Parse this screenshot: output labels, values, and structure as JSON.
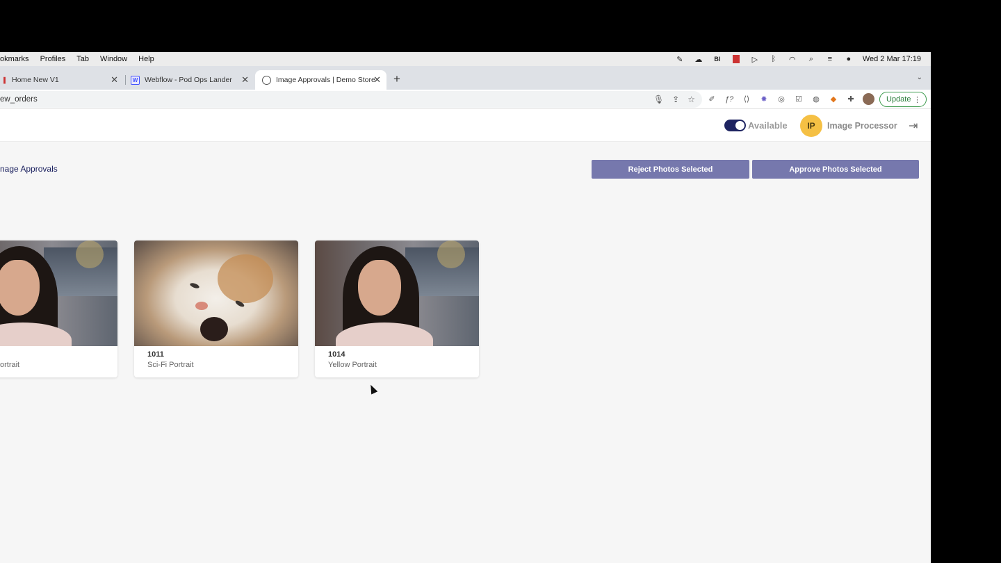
{
  "menubar": {
    "menus": [
      "okmarks",
      "Profiles",
      "Tab",
      "Window",
      "Help"
    ],
    "clock": "Wed 2 Mar  17:19"
  },
  "tabs": [
    {
      "title": "Home New V1",
      "favicon": "pdf-icon"
    },
    {
      "title": "Webflow - Pod Ops Lander",
      "favicon": "webflow-icon"
    },
    {
      "title": "Image Approvals | Demo Store",
      "favicon": "globe-icon"
    }
  ],
  "address": {
    "url": "ew_orders"
  },
  "update_label": "Update",
  "header": {
    "availability": "Available",
    "avatar_initials": "IP",
    "user_name": "Image Processor"
  },
  "page": {
    "breadcrumb": "nage Approvals",
    "reject_label": "Reject Photos Selected",
    "approve_label": "Approve Photos Selected"
  },
  "cards": [
    {
      "id": "",
      "name": "ortrait",
      "image": "portrait"
    },
    {
      "id": "1011",
      "name": "Sci-Fi Portrait",
      "image": "cat"
    },
    {
      "id": "1014",
      "name": "Yellow Portrait",
      "image": "portrait"
    }
  ],
  "colors": {
    "accent": "#7678ad",
    "toggle": "#1e2461",
    "avatar": "#f5c044"
  }
}
